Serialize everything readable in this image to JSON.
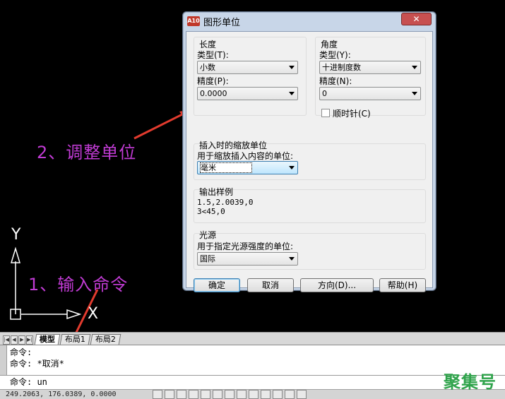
{
  "canvas": {
    "ucs": {
      "y_label": "Y",
      "x_label": "X"
    },
    "annotations": {
      "step2": "2、调整单位",
      "step1": "1、输入命令"
    },
    "annotation_color": "#c03bd3",
    "arrow_color": "#e23b2e"
  },
  "dialog": {
    "title": "图形单位",
    "app_icon_text": "A10",
    "close_label": "✕",
    "length": {
      "group_label": "长度",
      "type_label": "类型(T):",
      "type_value": "小数",
      "precision_label": "精度(P):",
      "precision_value": "0.0000"
    },
    "angle": {
      "group_label": "角度",
      "type_label": "类型(Y):",
      "type_value": "十进制度数",
      "precision_label": "精度(N):",
      "precision_value": "0",
      "clockwise_label": "顺时针(C)"
    },
    "insertion": {
      "group_label": "插入时的缩放单位",
      "units_label": "用于缩放插入内容的单位:",
      "units_value": "毫米"
    },
    "sample": {
      "group_label": "输出样例",
      "line1": "1.5,2.0039,0",
      "line2": "3<45,0"
    },
    "lighting": {
      "group_label": "光源",
      "units_label": "用于指定光源强度的单位:",
      "units_value": "国际"
    },
    "buttons": {
      "ok": "确定",
      "cancel": "取消",
      "direction": "方向(D)...",
      "help": "帮助(H)"
    }
  },
  "layout_tabs": {
    "nav": [
      "|◀",
      "◀",
      "▶",
      "▶|"
    ],
    "tabs": [
      "模型",
      "布局1",
      "布局2"
    ]
  },
  "command": {
    "history": [
      "命令:",
      "命令: *取消*"
    ],
    "current": "命令: un"
  },
  "status": {
    "coordinates": "249.2063, 176.0389, 0.0000"
  },
  "watermark": "聚集号"
}
